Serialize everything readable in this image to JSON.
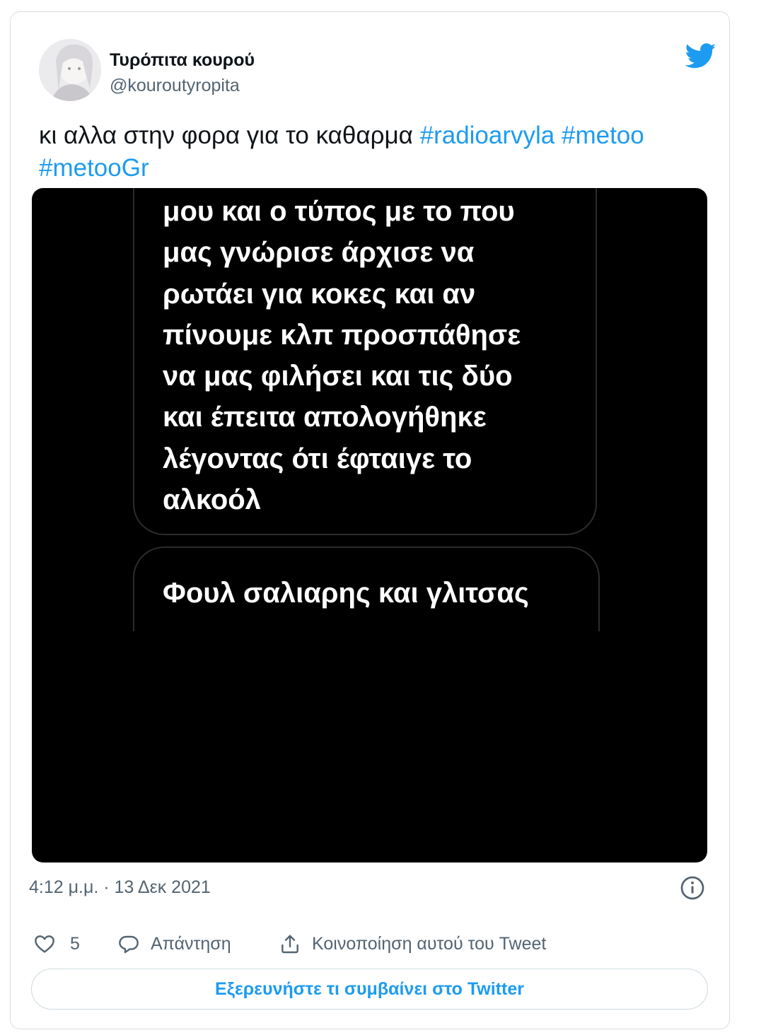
{
  "author": {
    "display_name": "Τυρόπιτα κουρού",
    "handle": "@kouroutyropita"
  },
  "tweet": {
    "text_plain": "κι αλλα στην φορα για το καθαρμα ",
    "hashtags": [
      "#radioarvyla",
      "#metoo",
      "#metooGr"
    ]
  },
  "media": {
    "bubble1_lines": [
      "μου και ο τύπος με το που",
      "μας γνώρισε άρχισε να",
      "ρωτάει για κοκες και αν",
      "πίνουμε κλπ  προσπάθησε",
      "να μας φιλήσει και τις δύο",
      "και έπειτα απολογήθηκε",
      "λέγοντας ότι έφταιγε το",
      "αλκοόλ"
    ],
    "bubble2_text": "Φουλ σαλιαρης και γλιτσας"
  },
  "meta": {
    "timestamp": "4:12 μ.μ. · 13 Δεκ 2021"
  },
  "actions": {
    "like_count": "5",
    "reply_label": "Απάντηση",
    "share_label": "Κοινοποίηση αυτού του Tweet"
  },
  "explore_label": "Εξερευνήστε τι συμβαίνει στο Twitter",
  "colors": {
    "accent": "#1d9bf0",
    "text": "#0f1419",
    "secondary": "#536471",
    "border": "#d9dde0"
  },
  "icons": [
    "avatar",
    "twitter-bird-icon",
    "info-icon",
    "heart-icon",
    "reply-bubble-icon",
    "share-icon"
  ]
}
